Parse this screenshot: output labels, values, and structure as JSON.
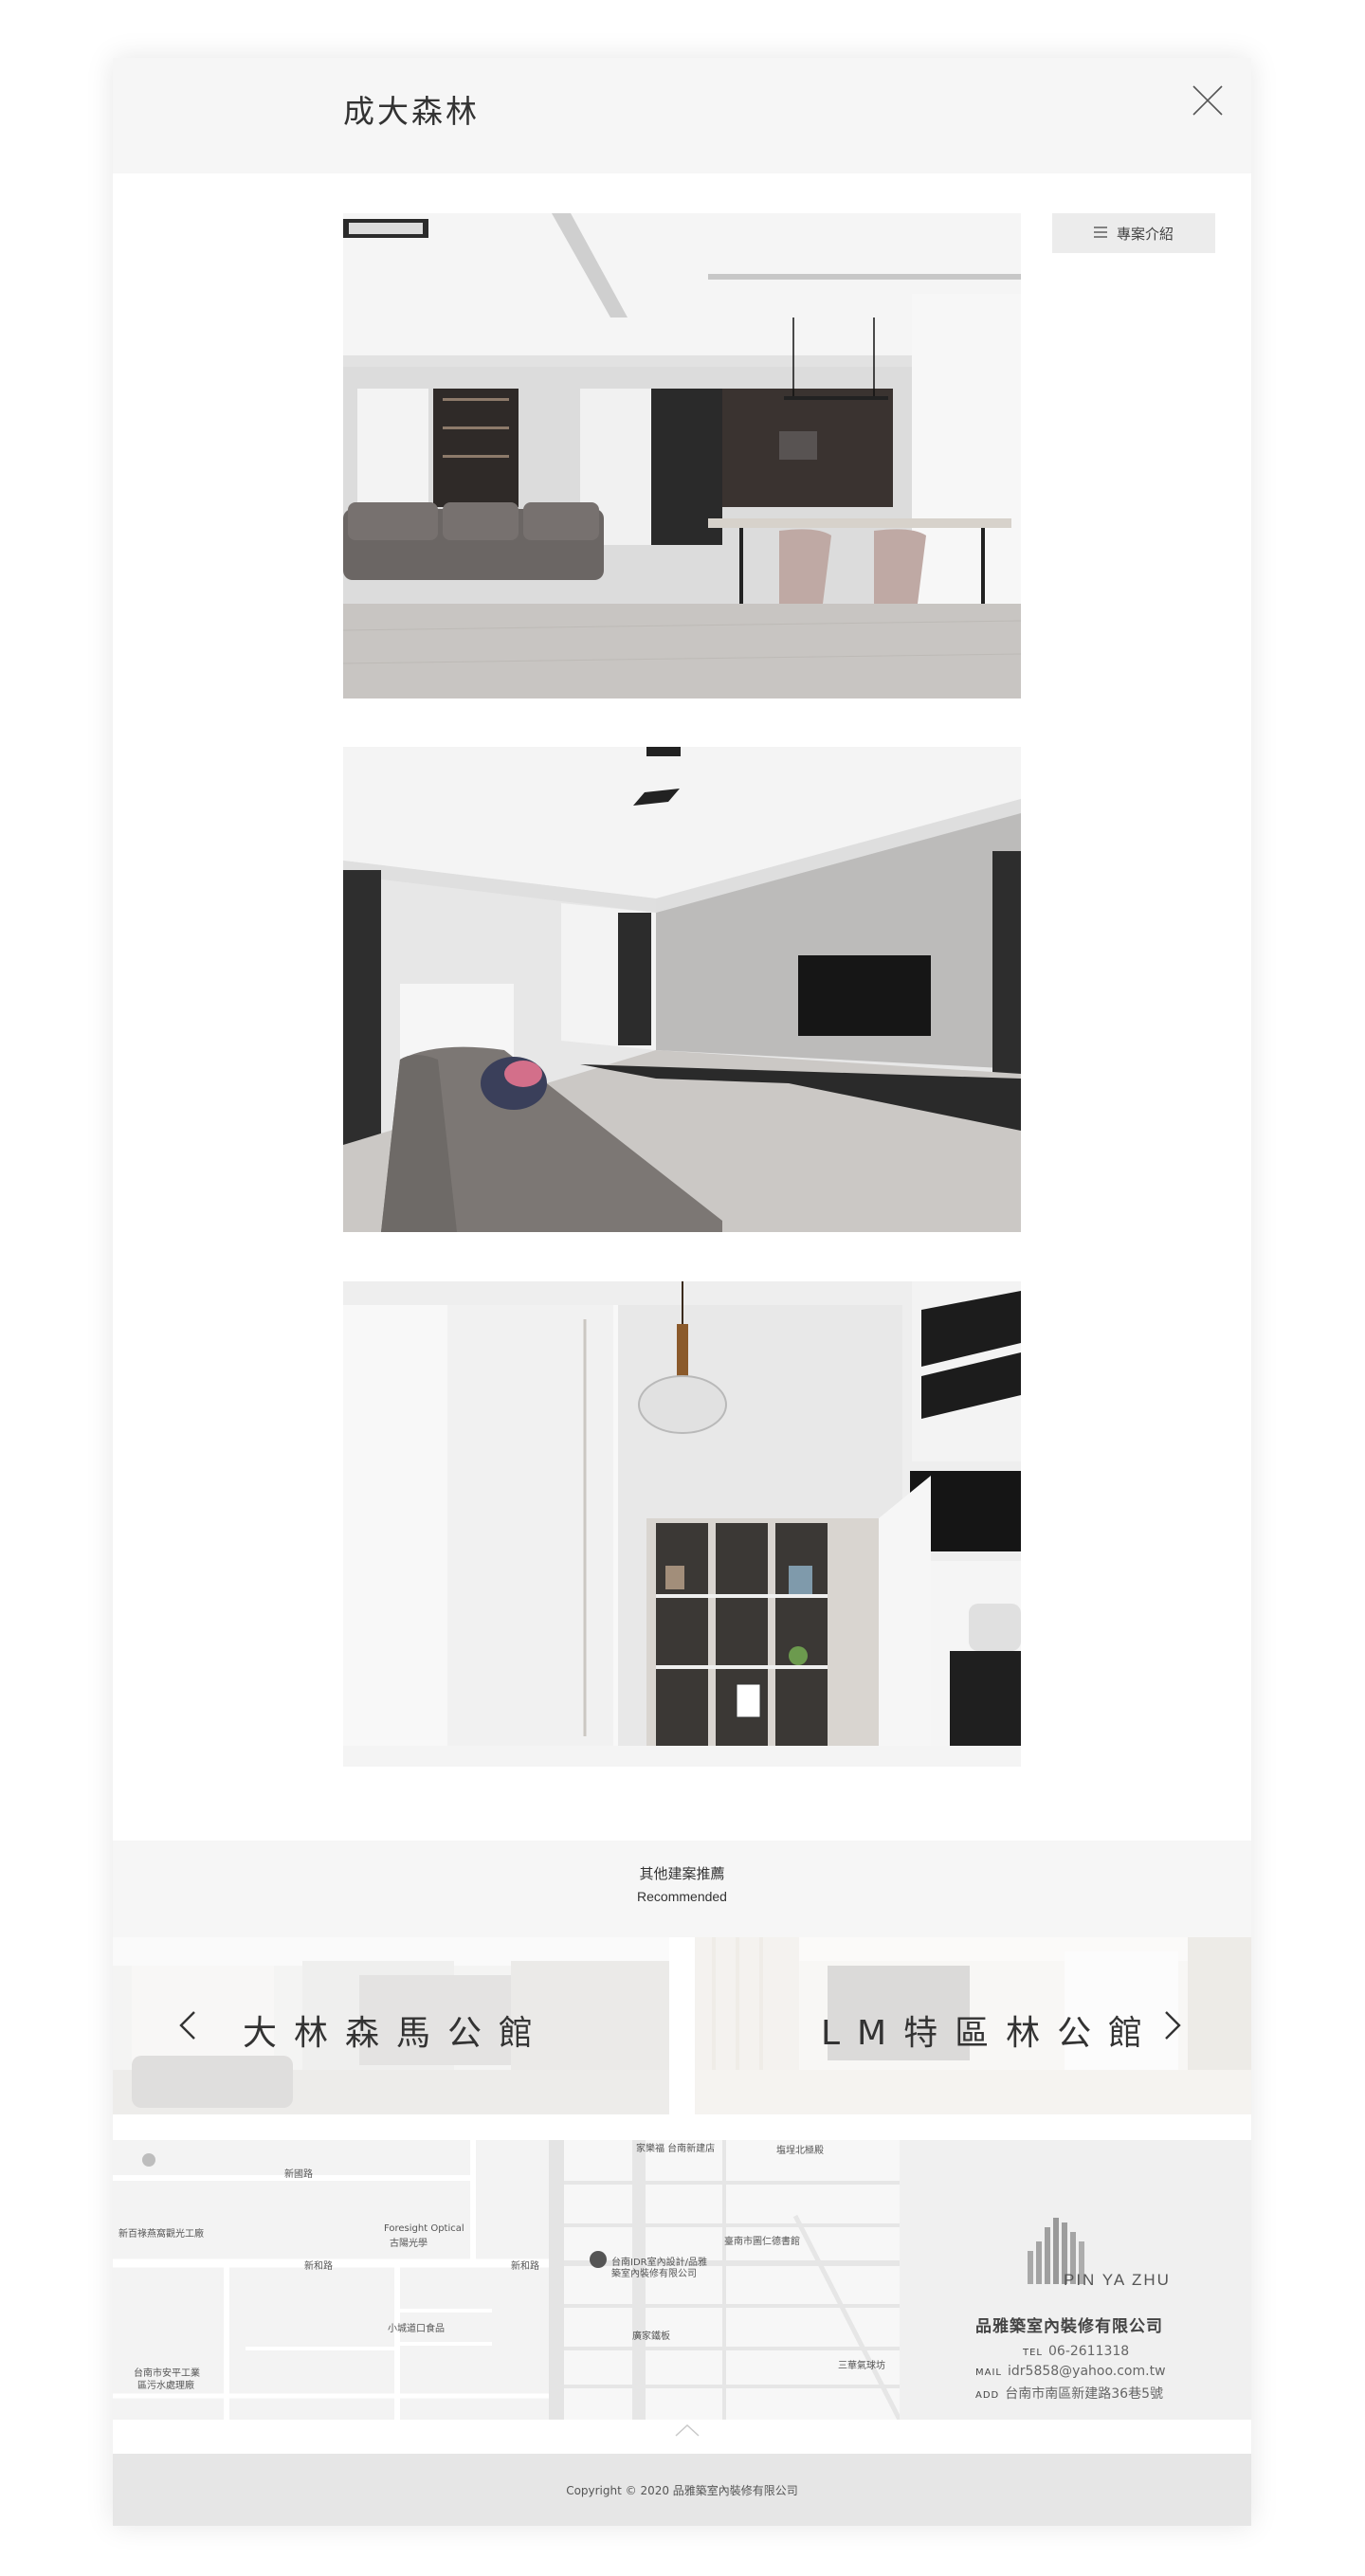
{
  "header": {
    "title": "成大森林",
    "close_icon": "close-icon"
  },
  "intro_button": {
    "label": "專案介紹",
    "icon": "list-icon"
  },
  "gallery": {
    "photos": [
      "living-dining-room",
      "living-room-tv-wall",
      "staircase-display-shelf"
    ]
  },
  "recommended": {
    "title": "其他建案推薦",
    "subtitle": "Recommended",
    "prev": {
      "label": "大林森馬公館",
      "icon": "chevron-left-icon"
    },
    "next": {
      "label": "LM特區林公館",
      "icon": "chevron-right-icon"
    }
  },
  "map": {
    "labels_left": [
      "新百祿燕窩觀光工廠",
      "Foresight Optical",
      "古陽光學",
      "新和路",
      "新和路",
      "小城道口食品",
      "台南市安平工業",
      "區污水處理廠",
      "新國路"
    ],
    "labels_right": [
      "家樂福 台南新建店",
      "塩埕北極殿",
      "臺南市圖仁德書館",
      "台南IDR室內設計/品雅",
      "築室內裝修有限公司",
      "廣家鐵板",
      "三華氣球坊"
    ]
  },
  "contact": {
    "logo_text": "PIN YA ZHU",
    "company": "品雅築室內裝修有限公司",
    "tel_key": "TEL",
    "tel": "06-2611318",
    "mail_key": "MAIL",
    "mail": "idr5858@yahoo.com.tw",
    "add_key": "ADD",
    "address": "台南市南區新建路36巷5號"
  },
  "footer": {
    "copyright": "Copyright © 2020 品雅築室內裝修有限公司"
  },
  "colors": {
    "header_bg": "#f6f6f6",
    "footer_bg": "#e6e6e6",
    "text": "#333333"
  }
}
